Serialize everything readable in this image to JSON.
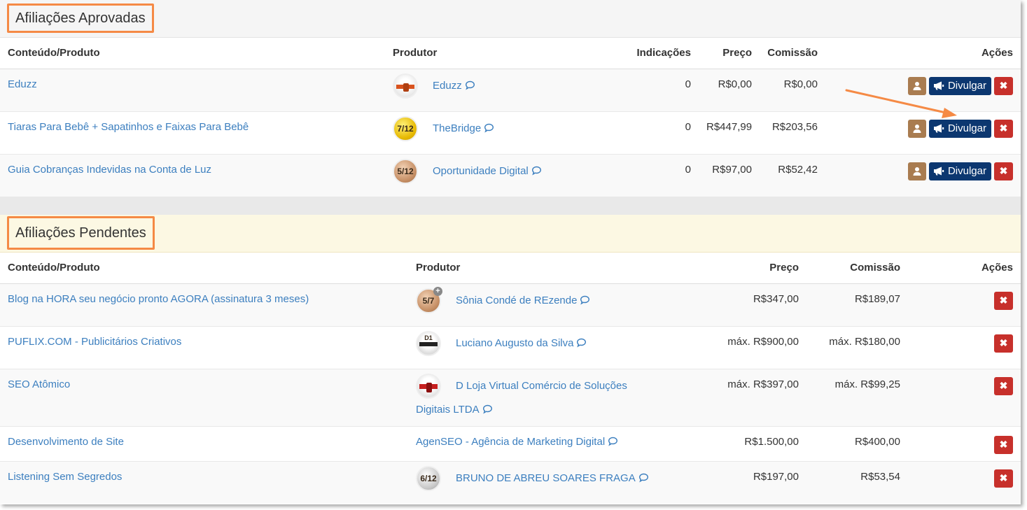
{
  "approved": {
    "title": "Afiliações Aprovadas",
    "columns": {
      "content": "Conteúdo/Produto",
      "producer": "Produtor",
      "referrals": "Indicações",
      "price": "Preço",
      "commission": "Comissão",
      "actions": "Ações"
    },
    "rows": [
      {
        "product": "Eduzz",
        "producer": "Eduzz",
        "avatar": "eduzz-badge",
        "referrals": "0",
        "price": "R$0,00",
        "commission": "R$0,00",
        "promote": "Divulgar"
      },
      {
        "product": "Tiaras Para Bebê + Sapatinhos e Faixas Para Bebê",
        "producer": "TheBridge",
        "avatar": "gold-7-12-badge",
        "avatar_text": "7/12",
        "referrals": "0",
        "price": "R$447,99",
        "commission": "R$203,56",
        "promote": "Divulgar"
      },
      {
        "product": "Guia Cobranças Indevidas na Conta de Luz",
        "producer": "Oportunidade Digital",
        "avatar": "bronze-5-12-badge",
        "avatar_text": "5/12",
        "referrals": "0",
        "price": "R$97,00",
        "commission": "R$52,42",
        "promote": "Divulgar"
      }
    ]
  },
  "pending": {
    "title": "Afiliações Pendentes",
    "columns": {
      "content": "Conteúdo/Produto",
      "producer": "Produtor",
      "price": "Preço",
      "commission": "Comissão",
      "actions": "Ações"
    },
    "rows": [
      {
        "product": "Blog na HORA seu negócio pronto AGORA (assinatura 3 meses)",
        "producer": "Sônia Condé de REzende",
        "avatar": "bronze-5-7-badge",
        "avatar_text": "5/7",
        "price": "R$347,00",
        "commission": "R$189,07"
      },
      {
        "product": "PUFLIX.COM - Publicitários Criativos",
        "producer": "Luciano Augusto da Silva",
        "avatar": "black-d1-badge",
        "avatar_text": "D1",
        "price": "máx. R$900,00",
        "commission": "máx. R$180,00"
      },
      {
        "product": "SEO Atômico",
        "producer": "D Loja Virtual Comércio de Soluções Digitais LTDA",
        "producer_line1": "D Loja Virtual Comércio de Soluções",
        "producer_line2": "Digitais LTDA",
        "avatar": "red-belt-badge",
        "price": "máx. R$397,00",
        "commission": "máx. R$99,25"
      },
      {
        "product": "Desenvolvimento de Site",
        "producer": "AgenSEO - Agência de Marketing Digital",
        "price": "R$1.500,00",
        "commission": "R$400,00"
      },
      {
        "product": "Listening Sem Segredos",
        "producer": "BRUNO DE ABREU SOARES FRAGA",
        "avatar": "silver-6-12-badge",
        "avatar_text": "6/12",
        "price": "R$197,00",
        "commission": "R$53,54"
      }
    ]
  },
  "colors": {
    "highlight": "#f58a45",
    "link": "#3c7fbf",
    "promote_button": "#0c3770",
    "user_button": "#a97c50",
    "delete_button": "#c7302b",
    "pending_header": "#fcf8e3"
  }
}
